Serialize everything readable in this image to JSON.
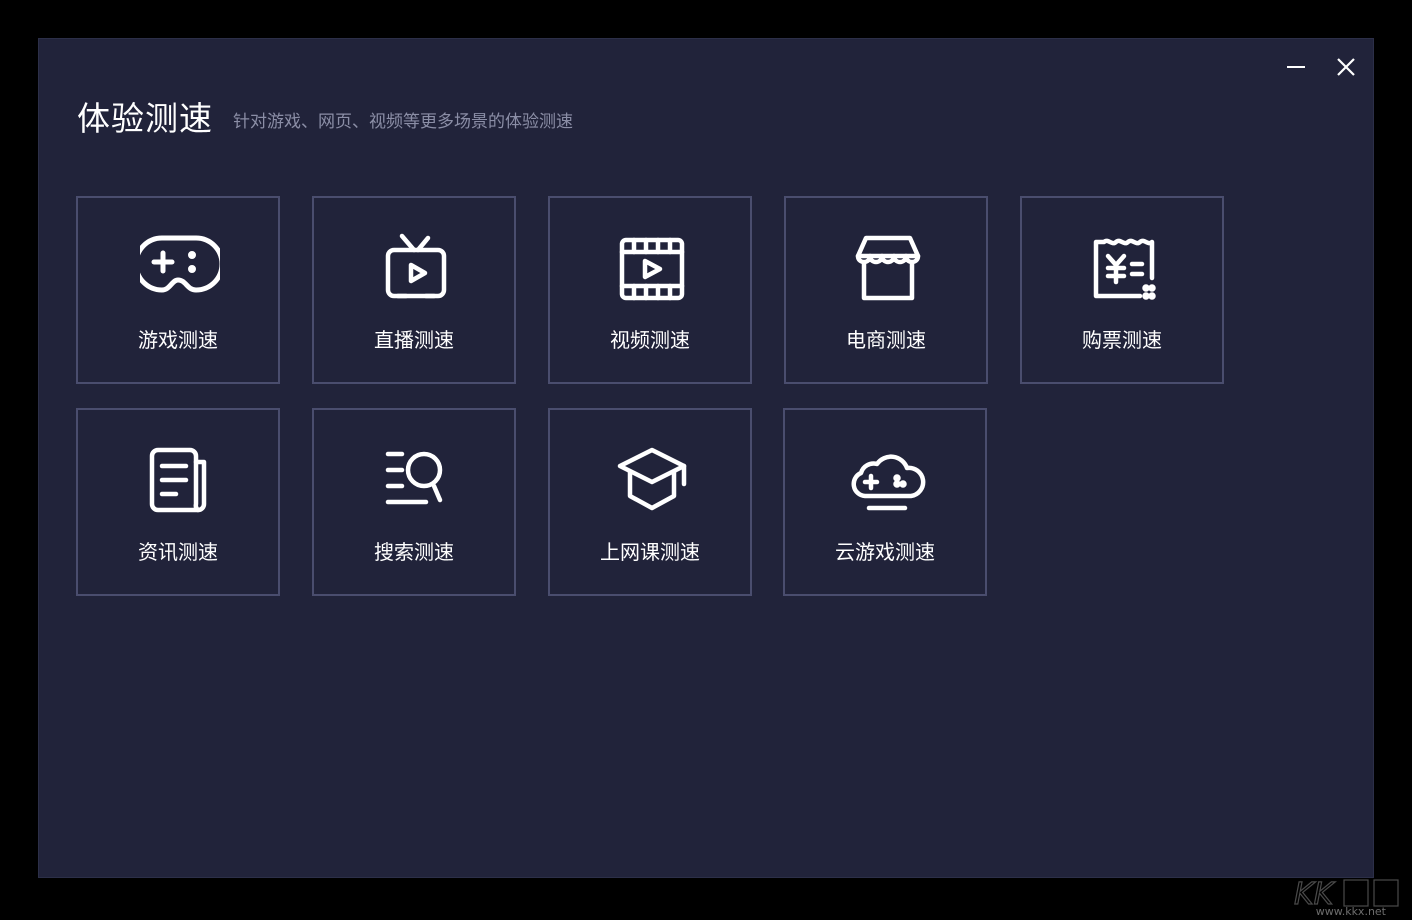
{
  "window": {
    "title": "体验测速",
    "subtitle": "针对游戏、网页、视频等更多场景的体验测速",
    "minimize_icon": "minimize-icon",
    "close_icon": "close-icon"
  },
  "tiles": [
    {
      "label": "游戏测速",
      "icon": "gamepad-icon"
    },
    {
      "label": "直播测速",
      "icon": "tv-live-icon"
    },
    {
      "label": "视频测速",
      "icon": "film-play-icon"
    },
    {
      "label": "电商测速",
      "icon": "storefront-icon"
    },
    {
      "label": "购票测速",
      "icon": "ticket-yen-icon"
    },
    {
      "label": "资讯测速",
      "icon": "news-document-icon"
    },
    {
      "label": "搜索测速",
      "icon": "search-list-icon"
    },
    {
      "label": "上网课测速",
      "icon": "graduation-cap-icon"
    },
    {
      "label": "云游戏测速",
      "icon": "cloud-gamepad-icon"
    }
  ],
  "watermark": {
    "url": "www.kkx.net"
  },
  "colors": {
    "background": "#21233a",
    "tile_border": "#4a4d6e",
    "text": "#ffffff",
    "subtitle": "#8b8ea6"
  }
}
